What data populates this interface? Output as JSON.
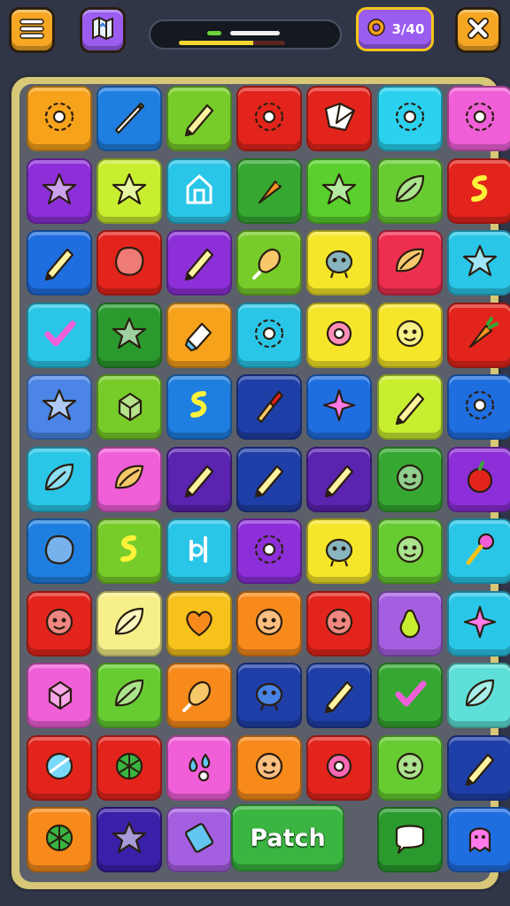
{
  "header": {
    "menu_icon": "hamburger-icon",
    "map_icon": "map-icon",
    "moves_label": "3/40",
    "moves_icon": "gear-icon",
    "close_icon": "close-icon",
    "progress_fraction": 0.7
  },
  "board": {
    "patch_label": "Patch",
    "rows": [
      [
        {
          "color": "#f7a21b",
          "icon": "gear-icon"
        },
        {
          "color": "#1f7fe0",
          "icon": "needle-icon"
        },
        {
          "color": "#78cc2a",
          "icon": "pencil-icon"
        },
        {
          "color": "#e3241c",
          "icon": "gear-icon"
        },
        {
          "color": "#e3241c",
          "icon": "origami-icon"
        },
        {
          "color": "#2ad2f0",
          "icon": "gear-icon"
        },
        {
          "color": "#f05fd8",
          "icon": "gear-icon"
        }
      ],
      [
        {
          "color": "#8c2fd8",
          "icon": "star-icon"
        },
        {
          "color": "#c8ee30",
          "icon": "star-icon"
        },
        {
          "color": "#2ac6e8",
          "icon": "house-icon"
        },
        {
          "color": "#36a832",
          "icon": "carrot-icon"
        },
        {
          "color": "#5ad02e",
          "icon": "star-icon"
        },
        {
          "color": "#66cc32",
          "icon": "leaf-icon"
        },
        {
          "color": "#e3241c",
          "icon": "swirl-icon"
        }
      ],
      [
        {
          "color": "#1f6ee0",
          "icon": "pencil-icon"
        },
        {
          "color": "#e3241c",
          "icon": "blob-icon"
        },
        {
          "color": "#8c2fd8",
          "icon": "pencil-icon"
        },
        {
          "color": "#78cc2a",
          "icon": "drumstick-icon"
        },
        {
          "color": "#f5e62a",
          "icon": "monster-icon"
        },
        {
          "color": "#ee2e4e",
          "icon": "shell-icon"
        },
        {
          "color": "#2ac6e8",
          "icon": "star-icon"
        }
      ],
      [
        {
          "color": "#2ac6e8",
          "icon": "check-icon"
        },
        {
          "color": "#2a9a2e",
          "icon": "star-icon"
        },
        {
          "color": "#f7a21b",
          "icon": "eraser-icon"
        },
        {
          "color": "#2ac6e8",
          "icon": "gear-icon"
        },
        {
          "color": "#f5e62a",
          "icon": "flower-icon"
        },
        {
          "color": "#f5e62a",
          "icon": "face-icon"
        },
        {
          "color": "#e3241c",
          "icon": "carrot-icon"
        }
      ],
      [
        {
          "color": "#4b86e6",
          "icon": "star-icon"
        },
        {
          "color": "#78cc2a",
          "icon": "cube-icon"
        },
        {
          "color": "#1f7fe0",
          "icon": "swirl-icon"
        },
        {
          "color": "#1f3fa8",
          "icon": "brush-icon"
        },
        {
          "color": "#1f6ee0",
          "icon": "sparkle-icon"
        },
        {
          "color": "#c8ee30",
          "icon": "pencil-icon"
        },
        {
          "color": "#1f6ee0",
          "icon": "gear-icon"
        }
      ],
      [
        {
          "color": "#2ac6e8",
          "icon": "leaf-icon"
        },
        {
          "color": "#f05fd8",
          "icon": "shell-icon"
        },
        {
          "color": "#5a23b0",
          "icon": "pencil-icon"
        },
        {
          "color": "#1f3fa8",
          "icon": "pencil-icon"
        },
        {
          "color": "#5a23b0",
          "icon": "pencil-icon"
        },
        {
          "color": "#36a832",
          "icon": "face-icon"
        },
        {
          "color": "#8c2fd8",
          "icon": "apple-icon"
        }
      ],
      [
        {
          "color": "#1f7fe0",
          "icon": "blob-icon"
        },
        {
          "color": "#78cc2a",
          "icon": "swirl-icon"
        },
        {
          "color": "#2ac6e8",
          "icon": "tool-icon"
        },
        {
          "color": "#8c2fd8",
          "icon": "gear-icon"
        },
        {
          "color": "#f5e62a",
          "icon": "monster-icon"
        },
        {
          "color": "#66cc32",
          "icon": "face-icon"
        },
        {
          "color": "#2ac6e8",
          "icon": "key-icon"
        }
      ],
      [
        {
          "color": "#e3241c",
          "icon": "face-icon"
        },
        {
          "color": "#f7f08a",
          "icon": "leaf-icon"
        },
        {
          "color": "#f7c21b",
          "icon": "heart-icon"
        },
        {
          "color": "#f78a1b",
          "icon": "face-icon"
        },
        {
          "color": "#e3241c",
          "icon": "face-icon"
        },
        {
          "color": "#a45fe0",
          "icon": "pear-icon"
        },
        {
          "color": "#2ac6e8",
          "icon": "sparkle-icon"
        }
      ],
      [
        {
          "color": "#f05fd8",
          "icon": "cube-icon"
        },
        {
          "color": "#66cc32",
          "icon": "leaf-icon"
        },
        {
          "color": "#f78a1b",
          "icon": "drumstick-icon"
        },
        {
          "color": "#1f3fa8",
          "icon": "monster-icon"
        },
        {
          "color": "#1f3fa8",
          "icon": "pencil-icon"
        },
        {
          "color": "#36a832",
          "icon": "check-icon"
        },
        {
          "color": "#5ee0d8",
          "icon": "leaf-icon"
        }
      ],
      [
        {
          "color": "#e3241c",
          "icon": "gem-icon"
        },
        {
          "color": "#e3241c",
          "icon": "ball-icon"
        },
        {
          "color": "#f05fd8",
          "icon": "drops-icon"
        },
        {
          "color": "#f78a1b",
          "icon": "face-icon"
        },
        {
          "color": "#e3241c",
          "icon": "flower-icon"
        },
        {
          "color": "#66cc32",
          "icon": "face-icon"
        },
        {
          "color": "#1f3fa8",
          "icon": "pencil-icon"
        }
      ],
      [
        {
          "color": "#f78a1b",
          "icon": "ball-icon"
        },
        {
          "color": "#3a1fa8",
          "icon": "star-icon"
        },
        {
          "color": "#a45fe0",
          "icon": "phone-icon"
        },
        null,
        {
          "color": "#2a9a2e",
          "icon": "speech-bubble-icon"
        },
        {
          "color": "#1f6ee0",
          "icon": "ghost-icon"
        }
      ]
    ]
  }
}
